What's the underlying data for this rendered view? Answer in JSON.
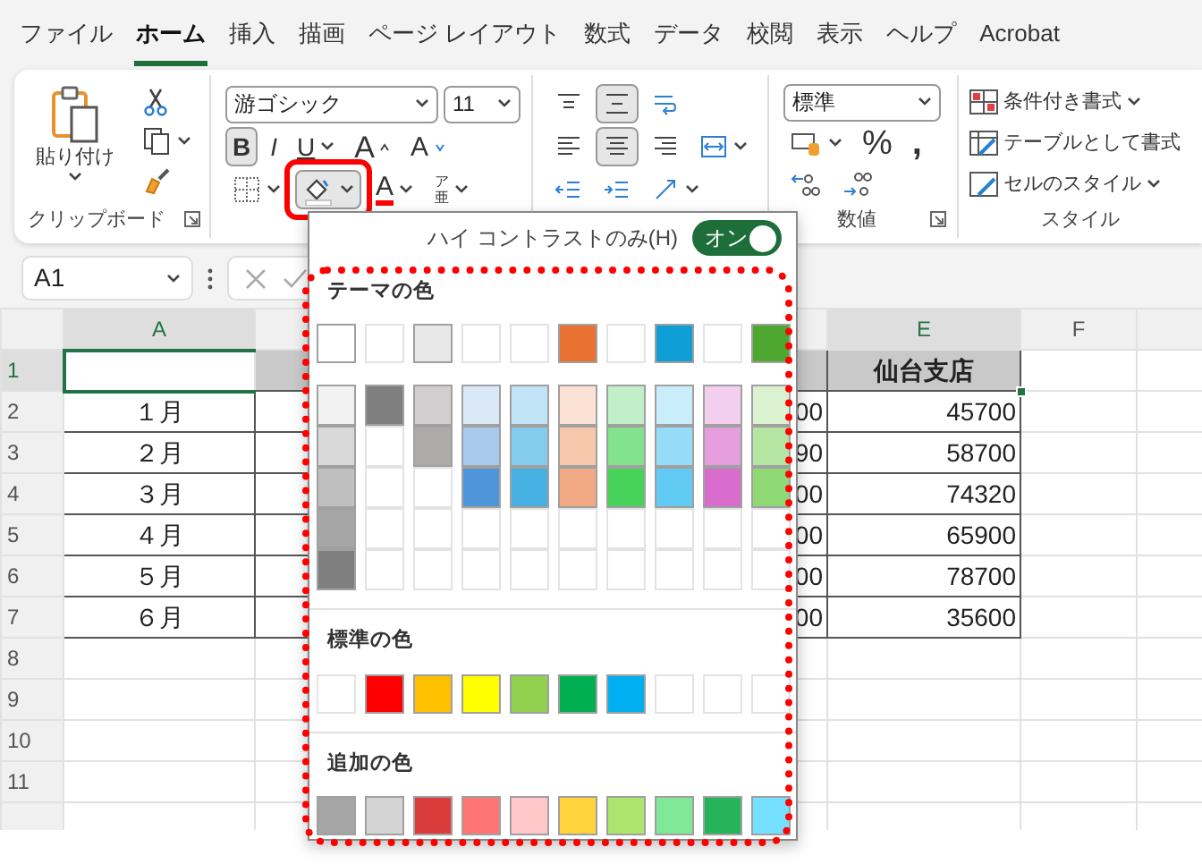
{
  "tabs": [
    {
      "label": "ファイル",
      "selected": false
    },
    {
      "label": "ホーム",
      "selected": true
    },
    {
      "label": "挿入",
      "selected": false
    },
    {
      "label": "描画",
      "selected": false
    },
    {
      "label": "ページ レイアウト",
      "selected": false
    },
    {
      "label": "数式",
      "selected": false
    },
    {
      "label": "データ",
      "selected": false
    },
    {
      "label": "校閲",
      "selected": false
    },
    {
      "label": "表示",
      "selected": false
    },
    {
      "label": "ヘルプ",
      "selected": false
    },
    {
      "label": "Acrobat",
      "selected": false
    }
  ],
  "ribbon": {
    "clipboard": {
      "paste_label": "貼り付け",
      "group_label": "クリップボード"
    },
    "font": {
      "font_name": "游ゴシック",
      "font_size": "11",
      "bold": {
        "label": "B",
        "on": true
      },
      "italic": {
        "label": "I",
        "on": false
      },
      "underline": {
        "label": "U",
        "on": false
      },
      "grow_label": "A",
      "shrink_label": "A",
      "font_color_label": "A",
      "phonetic_top": "ア",
      "phonetic_bottom": "亜",
      "fill_open": true
    },
    "alignment": {
      "buttons": [
        {
          "kind": "top",
          "on": false
        },
        {
          "kind": "middle",
          "on": true
        },
        {
          "kind": "wrap",
          "on": false
        },
        {
          "kind": "left",
          "on": false
        },
        {
          "kind": "center",
          "on": true
        },
        {
          "kind": "right",
          "on": false
        },
        {
          "kind": "merge",
          "on": false
        },
        {
          "kind": "outdent",
          "on": false
        },
        {
          "kind": "indent",
          "on": false
        },
        {
          "kind": "orientation",
          "on": false
        }
      ]
    },
    "number": {
      "format": "標準",
      "percent": "%",
      "comma": ",",
      "group_label": "数値"
    },
    "styles": {
      "items": [
        {
          "label": "条件付き書式",
          "dropdown": true
        },
        {
          "label": "テーブルとして書式",
          "dropdown": false
        },
        {
          "label": "セルのスタイル",
          "dropdown": true
        }
      ],
      "group_label": "スタイル"
    }
  },
  "formula_bar": {
    "name_box": "A1"
  },
  "grid": {
    "columns": [
      {
        "label": "A",
        "selected": true
      },
      {
        "label": "E",
        "selected": true
      },
      {
        "label": "F",
        "selected": false
      }
    ],
    "rows": [
      {
        "number": "1",
        "selected": true,
        "kind": "header",
        "E": "仙台支店"
      },
      {
        "number": "2",
        "selected": false,
        "kind": "data",
        "A": "１月",
        "D": "00",
        "E": "45700"
      },
      {
        "number": "3",
        "selected": false,
        "kind": "data",
        "A": "２月",
        "D": "90",
        "E": "58700"
      },
      {
        "number": "4",
        "selected": false,
        "kind": "data",
        "A": "３月",
        "D": "00",
        "E": "74320"
      },
      {
        "number": "5",
        "selected": false,
        "kind": "data",
        "A": "４月",
        "D": "00",
        "E": "65900"
      },
      {
        "number": "6",
        "selected": false,
        "kind": "data",
        "A": "５月",
        "D": "00",
        "E": "78700"
      },
      {
        "number": "7",
        "selected": false,
        "kind": "data",
        "A": "６月",
        "D": "00",
        "E": "35600"
      },
      {
        "number": "8",
        "selected": false,
        "kind": "blank"
      },
      {
        "number": "9",
        "selected": false,
        "kind": "blank"
      },
      {
        "number": "10",
        "selected": false,
        "kind": "blank"
      },
      {
        "number": "11",
        "selected": false,
        "kind": "blank"
      }
    ]
  },
  "dropdown": {
    "high_contrast_label": "ハイ コントラストのみ(H)",
    "high_contrast": {
      "label": "オン",
      "on": true
    },
    "sections": [
      {
        "title": "テーマの色",
        "rows": [
          [
            {
              "kind": "swatch",
              "color": "#ffffff"
            },
            {
              "kind": "empty"
            },
            {
              "kind": "swatch",
              "color": "#e8e8e8"
            },
            {
              "kind": "empty"
            },
            {
              "kind": "empty"
            },
            {
              "kind": "swatch",
              "color": "#e97132"
            },
            {
              "kind": "empty"
            },
            {
              "kind": "swatch",
              "color": "#0f9ed5"
            },
            {
              "kind": "empty"
            },
            {
              "kind": "swatch",
              "color": "#4ea72e"
            }
          ],
          [
            {
              "kind": "swatch",
              "color": "#f2f2f2"
            },
            {
              "kind": "swatch",
              "color": "#7f7f7f"
            },
            {
              "kind": "swatch",
              "color": "#d0cece"
            },
            {
              "kind": "swatch",
              "color": "#dae9f7"
            },
            {
              "kind": "swatch",
              "color": "#c0e4f5"
            },
            {
              "kind": "swatch",
              "color": "#fbe2d5"
            },
            {
              "kind": "swatch",
              "color": "#c1f0c8"
            },
            {
              "kind": "swatch",
              "color": "#caedfb"
            },
            {
              "kind": "swatch",
              "color": "#f2ceef"
            },
            {
              "kind": "swatch",
              "color": "#daf2d0"
            }
          ],
          [
            {
              "kind": "swatch",
              "color": "#d9d9d9"
            },
            {
              "kind": "empty"
            },
            {
              "kind": "swatch",
              "color": "#aeaaaa"
            },
            {
              "kind": "swatch",
              "color": "#a6c9ec"
            },
            {
              "kind": "swatch",
              "color": "#83cceb"
            },
            {
              "kind": "swatch",
              "color": "#f7c7ac"
            },
            {
              "kind": "swatch",
              "color": "#83e28e"
            },
            {
              "kind": "swatch",
              "color": "#94dcf8"
            },
            {
              "kind": "swatch",
              "color": "#e49edd"
            },
            {
              "kind": "swatch",
              "color": "#b4e5a2"
            }
          ],
          [
            {
              "kind": "swatch",
              "color": "#bfbfbf"
            },
            {
              "kind": "empty"
            },
            {
              "kind": "empty"
            },
            {
              "kind": "swatch",
              "color": "#4e95d9"
            },
            {
              "kind": "swatch",
              "color": "#45b0e1"
            },
            {
              "kind": "swatch",
              "color": "#f1a983"
            },
            {
              "kind": "swatch",
              "color": "#47d359"
            },
            {
              "kind": "swatch",
              "color": "#61cbf3"
            },
            {
              "kind": "swatch",
              "color": "#d86dcd"
            },
            {
              "kind": "swatch",
              "color": "#8ed973"
            }
          ],
          [
            {
              "kind": "swatch",
              "color": "#a6a6a6"
            },
            {
              "kind": "empty"
            },
            {
              "kind": "empty"
            },
            {
              "kind": "empty"
            },
            {
              "kind": "empty"
            },
            {
              "kind": "empty"
            },
            {
              "kind": "empty"
            },
            {
              "kind": "empty"
            },
            {
              "kind": "empty"
            },
            {
              "kind": "empty"
            }
          ],
          [
            {
              "kind": "swatch",
              "color": "#7f7f7f"
            },
            {
              "kind": "empty"
            },
            {
              "kind": "empty"
            },
            {
              "kind": "empty"
            },
            {
              "kind": "empty"
            },
            {
              "kind": "empty"
            },
            {
              "kind": "empty"
            },
            {
              "kind": "empty"
            },
            {
              "kind": "empty"
            },
            {
              "kind": "empty"
            }
          ]
        ]
      },
      {
        "title": "標準の色",
        "rows": [
          [
            {
              "kind": "empty"
            },
            {
              "kind": "swatch",
              "color": "#ff0000"
            },
            {
              "kind": "swatch",
              "color": "#ffc000"
            },
            {
              "kind": "swatch",
              "color": "#ffff00"
            },
            {
              "kind": "swatch",
              "color": "#92d050"
            },
            {
              "kind": "swatch",
              "color": "#00b050"
            },
            {
              "kind": "swatch",
              "color": "#00b0f0"
            },
            {
              "kind": "empty"
            },
            {
              "kind": "empty"
            },
            {
              "kind": "empty"
            }
          ]
        ]
      },
      {
        "title": "追加の色",
        "rows": [
          [
            {
              "kind": "swatch",
              "color": "#a5a5a5"
            },
            {
              "kind": "swatch",
              "color": "#d4d4d4"
            },
            {
              "kind": "swatch",
              "color": "#da3b3b"
            },
            {
              "kind": "swatch",
              "color": "#ff7575"
            },
            {
              "kind": "swatch",
              "color": "#ffc7c7"
            },
            {
              "kind": "swatch",
              "color": "#ffd33b"
            },
            {
              "kind": "swatch",
              "color": "#ade56f"
            },
            {
              "kind": "swatch",
              "color": "#80e896"
            },
            {
              "kind": "swatch",
              "color": "#26b45a"
            },
            {
              "kind": "swatch",
              "color": "#75e0ff"
            }
          ]
        ]
      }
    ]
  }
}
